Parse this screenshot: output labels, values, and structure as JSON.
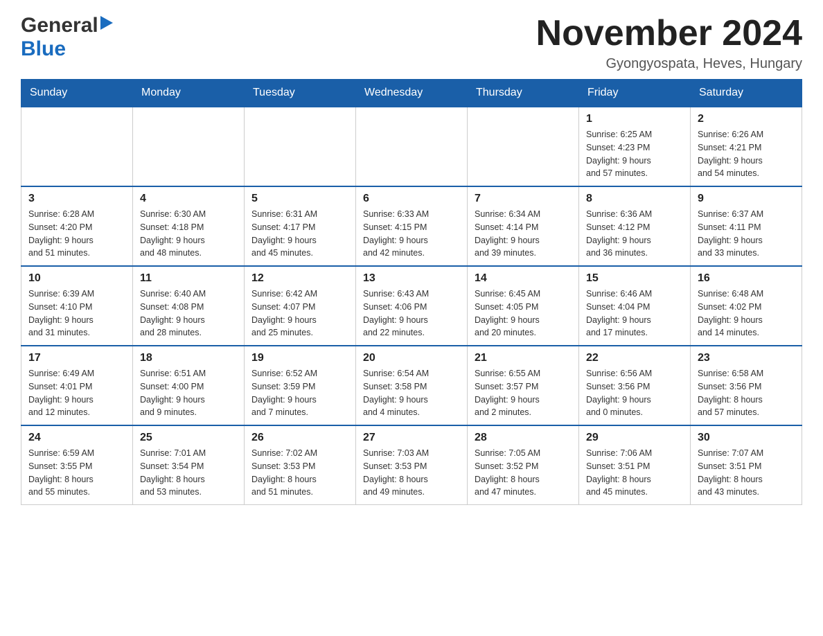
{
  "header": {
    "logo_general": "General",
    "logo_blue": "Blue",
    "month_title": "November 2024",
    "location": "Gyongyospata, Heves, Hungary"
  },
  "weekdays": [
    "Sunday",
    "Monday",
    "Tuesday",
    "Wednesday",
    "Thursday",
    "Friday",
    "Saturday"
  ],
  "weeks": [
    [
      {
        "day": "",
        "info": ""
      },
      {
        "day": "",
        "info": ""
      },
      {
        "day": "",
        "info": ""
      },
      {
        "day": "",
        "info": ""
      },
      {
        "day": "",
        "info": ""
      },
      {
        "day": "1",
        "info": "Sunrise: 6:25 AM\nSunset: 4:23 PM\nDaylight: 9 hours\nand 57 minutes."
      },
      {
        "day": "2",
        "info": "Sunrise: 6:26 AM\nSunset: 4:21 PM\nDaylight: 9 hours\nand 54 minutes."
      }
    ],
    [
      {
        "day": "3",
        "info": "Sunrise: 6:28 AM\nSunset: 4:20 PM\nDaylight: 9 hours\nand 51 minutes."
      },
      {
        "day": "4",
        "info": "Sunrise: 6:30 AM\nSunset: 4:18 PM\nDaylight: 9 hours\nand 48 minutes."
      },
      {
        "day": "5",
        "info": "Sunrise: 6:31 AM\nSunset: 4:17 PM\nDaylight: 9 hours\nand 45 minutes."
      },
      {
        "day": "6",
        "info": "Sunrise: 6:33 AM\nSunset: 4:15 PM\nDaylight: 9 hours\nand 42 minutes."
      },
      {
        "day": "7",
        "info": "Sunrise: 6:34 AM\nSunset: 4:14 PM\nDaylight: 9 hours\nand 39 minutes."
      },
      {
        "day": "8",
        "info": "Sunrise: 6:36 AM\nSunset: 4:12 PM\nDaylight: 9 hours\nand 36 minutes."
      },
      {
        "day": "9",
        "info": "Sunrise: 6:37 AM\nSunset: 4:11 PM\nDaylight: 9 hours\nand 33 minutes."
      }
    ],
    [
      {
        "day": "10",
        "info": "Sunrise: 6:39 AM\nSunset: 4:10 PM\nDaylight: 9 hours\nand 31 minutes."
      },
      {
        "day": "11",
        "info": "Sunrise: 6:40 AM\nSunset: 4:08 PM\nDaylight: 9 hours\nand 28 minutes."
      },
      {
        "day": "12",
        "info": "Sunrise: 6:42 AM\nSunset: 4:07 PM\nDaylight: 9 hours\nand 25 minutes."
      },
      {
        "day": "13",
        "info": "Sunrise: 6:43 AM\nSunset: 4:06 PM\nDaylight: 9 hours\nand 22 minutes."
      },
      {
        "day": "14",
        "info": "Sunrise: 6:45 AM\nSunset: 4:05 PM\nDaylight: 9 hours\nand 20 minutes."
      },
      {
        "day": "15",
        "info": "Sunrise: 6:46 AM\nSunset: 4:04 PM\nDaylight: 9 hours\nand 17 minutes."
      },
      {
        "day": "16",
        "info": "Sunrise: 6:48 AM\nSunset: 4:02 PM\nDaylight: 9 hours\nand 14 minutes."
      }
    ],
    [
      {
        "day": "17",
        "info": "Sunrise: 6:49 AM\nSunset: 4:01 PM\nDaylight: 9 hours\nand 12 minutes."
      },
      {
        "day": "18",
        "info": "Sunrise: 6:51 AM\nSunset: 4:00 PM\nDaylight: 9 hours\nand 9 minutes."
      },
      {
        "day": "19",
        "info": "Sunrise: 6:52 AM\nSunset: 3:59 PM\nDaylight: 9 hours\nand 7 minutes."
      },
      {
        "day": "20",
        "info": "Sunrise: 6:54 AM\nSunset: 3:58 PM\nDaylight: 9 hours\nand 4 minutes."
      },
      {
        "day": "21",
        "info": "Sunrise: 6:55 AM\nSunset: 3:57 PM\nDaylight: 9 hours\nand 2 minutes."
      },
      {
        "day": "22",
        "info": "Sunrise: 6:56 AM\nSunset: 3:56 PM\nDaylight: 9 hours\nand 0 minutes."
      },
      {
        "day": "23",
        "info": "Sunrise: 6:58 AM\nSunset: 3:56 PM\nDaylight: 8 hours\nand 57 minutes."
      }
    ],
    [
      {
        "day": "24",
        "info": "Sunrise: 6:59 AM\nSunset: 3:55 PM\nDaylight: 8 hours\nand 55 minutes."
      },
      {
        "day": "25",
        "info": "Sunrise: 7:01 AM\nSunset: 3:54 PM\nDaylight: 8 hours\nand 53 minutes."
      },
      {
        "day": "26",
        "info": "Sunrise: 7:02 AM\nSunset: 3:53 PM\nDaylight: 8 hours\nand 51 minutes."
      },
      {
        "day": "27",
        "info": "Sunrise: 7:03 AM\nSunset: 3:53 PM\nDaylight: 8 hours\nand 49 minutes."
      },
      {
        "day": "28",
        "info": "Sunrise: 7:05 AM\nSunset: 3:52 PM\nDaylight: 8 hours\nand 47 minutes."
      },
      {
        "day": "29",
        "info": "Sunrise: 7:06 AM\nSunset: 3:51 PM\nDaylight: 8 hours\nand 45 minutes."
      },
      {
        "day": "30",
        "info": "Sunrise: 7:07 AM\nSunset: 3:51 PM\nDaylight: 8 hours\nand 43 minutes."
      }
    ]
  ]
}
